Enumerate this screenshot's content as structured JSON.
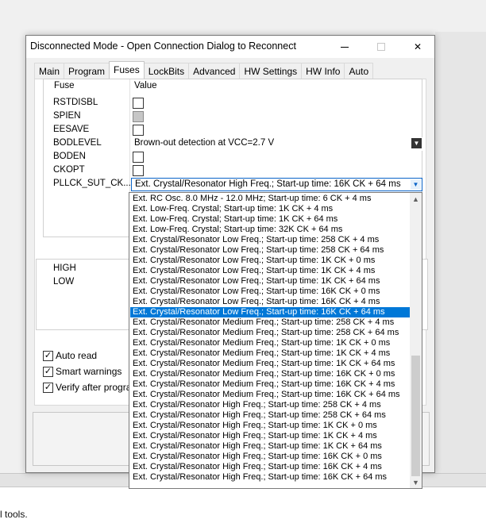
{
  "background": {
    "bottom_text": "l tools."
  },
  "dialog": {
    "title": "Disconnected Mode - Open Connection Dialog to Reconnect",
    "close_glyph": "✕"
  },
  "tabs": [
    {
      "label": "Main"
    },
    {
      "label": "Program"
    },
    {
      "label": "Fuses"
    },
    {
      "label": "LockBits"
    },
    {
      "label": "Advanced"
    },
    {
      "label": "HW Settings"
    },
    {
      "label": "HW Info"
    },
    {
      "label": "Auto"
    }
  ],
  "fuses": {
    "header_fuse": "Fuse",
    "header_value": "Value",
    "rows": [
      {
        "label": "RSTDISBL",
        "checked": false
      },
      {
        "label": "SPIEN",
        "checked": true
      },
      {
        "label": "EESAVE",
        "checked": false
      },
      {
        "label": "BODLEVEL",
        "value": "Brown-out detection at VCC=2.7 V"
      },
      {
        "label": "BODEN",
        "checked": false
      },
      {
        "label": "CKOPT",
        "checked": false
      },
      {
        "label": "PLLCK_SUT_CK...",
        "value": "Ext. Crystal/Resonator High Freq.; Start-up time: 16K CK + 64 ms"
      }
    ]
  },
  "fuse_bytes": {
    "rows": [
      {
        "label": "HIGH"
      },
      {
        "label": "LOW"
      }
    ]
  },
  "options": [
    {
      "label": "Auto read",
      "checked": true
    },
    {
      "label": "Smart warnings",
      "checked": true
    },
    {
      "label": "Verify after programm",
      "checked": true
    }
  ],
  "dropdown": {
    "selected_index": 11,
    "items": [
      "Ext. RC Osc. 8.0 MHz - 12.0 MHz; Start-up time: 6 CK + 4 ms",
      "Ext. Low-Freq. Crystal; Start-up time: 1K CK + 4 ms",
      "Ext. Low-Freq. Crystal; Start-up time: 1K CK + 64 ms",
      "Ext. Low-Freq. Crystal; Start-up time: 32K CK + 64 ms",
      "Ext. Crystal/Resonator Low Freq.; Start-up time: 258 CK + 4 ms",
      "Ext. Crystal/Resonator Low Freq.; Start-up time: 258 CK + 64 ms",
      "Ext. Crystal/Resonator Low Freq.; Start-up time: 1K CK + 0 ms",
      "Ext. Crystal/Resonator Low Freq.; Start-up time: 1K CK + 4 ms",
      "Ext. Crystal/Resonator Low Freq.; Start-up time: 1K CK + 64 ms",
      "Ext. Crystal/Resonator Low Freq.; Start-up time: 16K CK + 0 ms",
      "Ext. Crystal/Resonator Low Freq.; Start-up time: 16K CK + 4 ms",
      "Ext. Crystal/Resonator Low Freq.; Start-up time: 16K CK + 64 ms",
      "Ext. Crystal/Resonator Medium Freq.; Start-up time: 258 CK + 4 ms",
      "Ext. Crystal/Resonator Medium Freq.; Start-up time: 258 CK + 64 ms",
      "Ext. Crystal/Resonator Medium Freq.; Start-up time: 1K CK + 0 ms",
      "Ext. Crystal/Resonator Medium Freq.; Start-up time: 1K CK + 4 ms",
      "Ext. Crystal/Resonator Medium Freq.; Start-up time: 1K CK + 64 ms",
      "Ext. Crystal/Resonator Medium Freq.; Start-up time: 16K CK + 0 ms",
      "Ext. Crystal/Resonator Medium Freq.; Start-up time: 16K CK + 4 ms",
      "Ext. Crystal/Resonator Medium Freq.; Start-up time: 16K CK + 64 ms",
      "Ext. Crystal/Resonator High Freq.; Start-up time: 258 CK + 4 ms",
      "Ext. Crystal/Resonator High Freq.; Start-up time: 258 CK + 64 ms",
      "Ext. Crystal/Resonator High Freq.; Start-up time: 1K CK + 0 ms",
      "Ext. Crystal/Resonator High Freq.; Start-up time: 1K CK + 4 ms",
      "Ext. Crystal/Resonator High Freq.; Start-up time: 1K CK + 64 ms",
      "Ext. Crystal/Resonator High Freq.; Start-up time: 16K CK + 0 ms",
      "Ext. Crystal/Resonator High Freq.; Start-up time: 16K CK + 4 ms",
      "Ext. Crystal/Resonator High Freq.; Start-up time: 16K CK + 64 ms"
    ]
  },
  "colors": {
    "selection": "#0078d7",
    "window_bg": "#f0f0f0"
  }
}
